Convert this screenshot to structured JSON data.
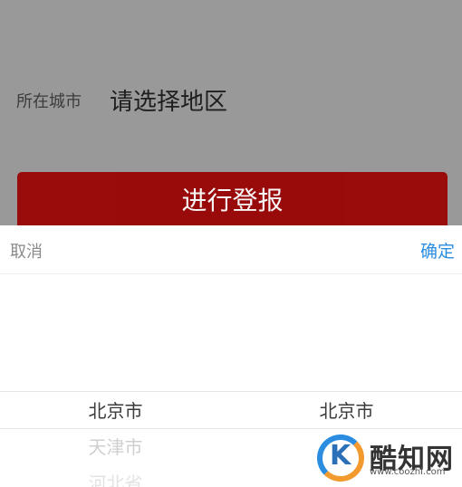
{
  "form": {
    "city_label": "所在城市",
    "city_placeholder": "请选择地区",
    "submit_label": "进行登报"
  },
  "picker": {
    "cancel_label": "取消",
    "confirm_label": "确定",
    "province_options": [
      "北京市",
      "天津市",
      "河北省"
    ],
    "city_options": [
      "北京市"
    ],
    "selected_index": 0
  },
  "watermark": {
    "brand": "酷知网",
    "url": "www.coozhi.com",
    "colors": {
      "blue": "#2a8de0",
      "orange": "#f29a2e"
    }
  },
  "colors": {
    "submit_button": "#9a0000",
    "confirm_text": "#2a8de0",
    "overlay": "#999999"
  }
}
